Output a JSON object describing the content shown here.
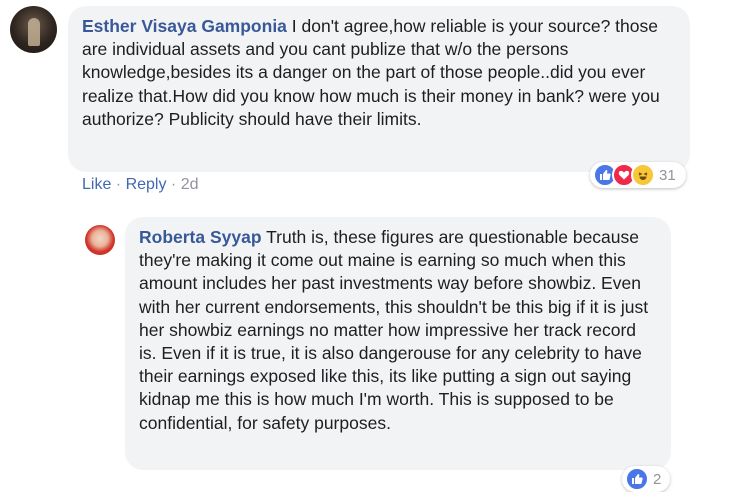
{
  "comment1": {
    "author": "Esther Visaya Gamponia",
    "text": "I don't agree,how reliable is your source? those are individual assets and you cant publize that w/o the persons knowledge,besides its a danger on the part of those people..did you ever realize that.How did you know how much is their money in bank? were you authorize? Publicity should have their limits.",
    "actions": {
      "like": "Like",
      "sep1": " · ",
      "reply": "Reply",
      "sep2": " · ",
      "time": "2d"
    },
    "reactions": {
      "icons": [
        "like-icon",
        "love-icon",
        "haha-icon"
      ],
      "count": "31"
    }
  },
  "comment2": {
    "author": "Roberta Syyap",
    "text": "Truth is, these figures are questionable because they're making it come out maine is earning so much when this amount includes her past investments way before showbiz. Even with her current endorsements, this shouldn't be this big if it is just her showbiz earnings no matter how impressive her track record is. Even if it is true, it is also dangerouse for any celebrity to have their earnings exposed like this, its like putting a sign out saying kidnap me this is how much I'm worth. This is supposed to be confidential, for safety purposes.",
    "reactions": {
      "icons": [
        "like-icon"
      ],
      "count": "2"
    }
  },
  "colors": {
    "author": "#385898",
    "link": "#4267b2",
    "bubble": "#f2f3f5",
    "meta": "#90949c"
  }
}
